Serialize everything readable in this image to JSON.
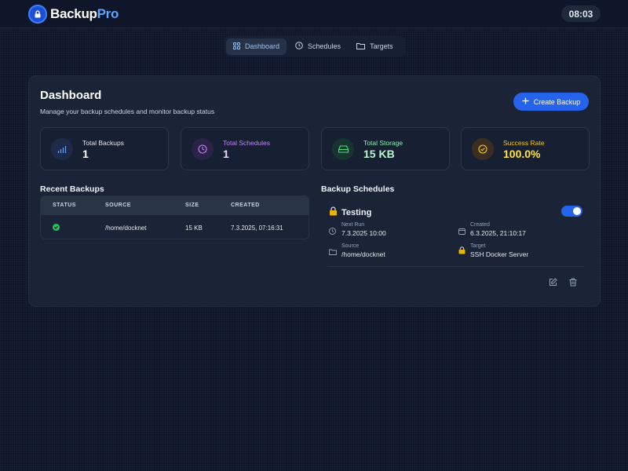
{
  "app": {
    "brand_main": "Backup",
    "brand_accent": "Pro",
    "clock": "08:03"
  },
  "nav": {
    "tabs": [
      {
        "label": "Dashboard",
        "icon": "grid-icon",
        "active": true
      },
      {
        "label": "Schedules",
        "icon": "clock-icon",
        "active": false
      },
      {
        "label": "Targets",
        "icon": "folder-icon",
        "active": false
      }
    ]
  },
  "dashboard": {
    "title": "Dashboard",
    "subtitle": "Manage your backup schedules and monitor backup status",
    "create_button": "Create Backup"
  },
  "stats": [
    {
      "label": "Total Backups",
      "value": "1",
      "icon": "bar-chart-icon",
      "color": "#60a5fa",
      "bg": "#1e2a4a"
    },
    {
      "label": "Total Schedules",
      "value": "1",
      "icon": "clock-icon",
      "color": "#c084fc",
      "bg": "#2a2347"
    },
    {
      "label": "Total Storage",
      "value": "15 KB",
      "icon": "hard-drive-icon",
      "color": "#4ade80",
      "bg": "#173530"
    },
    {
      "label": "Success Rate",
      "value": "100.0%",
      "icon": "check-circle-icon",
      "color": "#facc15",
      "bg": "#3a2e22"
    }
  ],
  "recent_backups": {
    "title": "Recent Backups",
    "columns": [
      "STATUS",
      "SOURCE",
      "SIZE",
      "CREATED"
    ],
    "rows": [
      {
        "status": "success",
        "source": "/home/docknet",
        "size": "15 KB",
        "created": "7.3.2025, 07:16:31"
      }
    ]
  },
  "backup_schedules": {
    "title": "Backup Schedules",
    "items": [
      {
        "name": "Testing",
        "enabled": true,
        "next_run_label": "Next Run",
        "next_run": "7.3.2025 10:00",
        "created_label": "Created",
        "created": "6.3.2025, 21:10:17",
        "source_label": "Source",
        "source": "/home/docknet",
        "target_label": "Target",
        "target": "SSH Docker Server"
      }
    ]
  }
}
